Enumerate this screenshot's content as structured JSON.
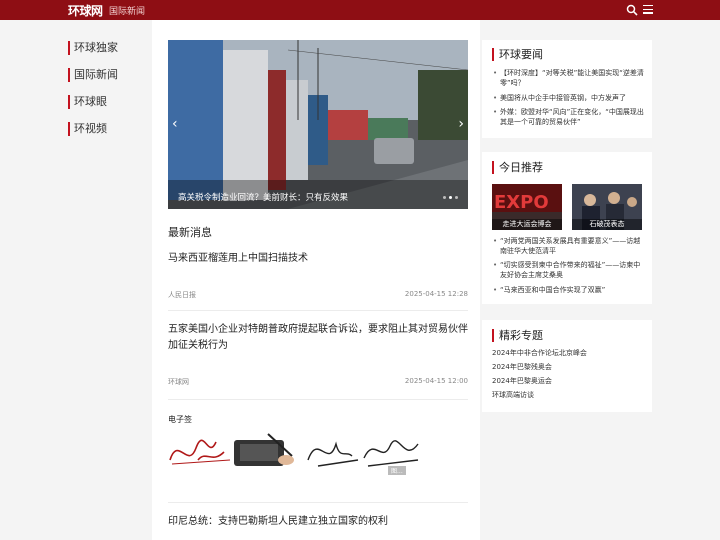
{
  "header": {
    "logo": "环球网",
    "section": "国际新闻"
  },
  "leftnav": {
    "items": [
      {
        "label": "环球独家"
      },
      {
        "label": "国际新闻"
      },
      {
        "label": "环球眼"
      },
      {
        "label": "环视频"
      }
    ]
  },
  "slider": {
    "caption": "高关税令制造业回流？美前财长：只有反效果",
    "total_slides": 3,
    "active_slide": 2
  },
  "latest": {
    "title": "最新消息",
    "items": [
      {
        "title": "马来西亚榴莲用上中国扫描技术",
        "source": "人民日报",
        "date": "2025-04-15 12:28"
      },
      {
        "title": "五家美国小企业对特朗普政府提起联合诉讼，要求阻止其对贸易伙伴加征关税行为",
        "source": "环球网",
        "date": "2025-04-15 12:00"
      }
    ],
    "esig_label": "电子签",
    "esig_watermark": "图...",
    "last_title": "印尼总统：支持巴勒斯坦人民建立独立国家的权利"
  },
  "hot": {
    "title": "环球要闻",
    "items": [
      "【环时深度】“对等关税”能让美国实现“逆差清零”吗？",
      "美国将从中企手中接管英钢，中方发声了",
      "外媒：欧盟对华“风向”正在变化，“中国展现出其是一个可靠的贸易伙伴”"
    ]
  },
  "today": {
    "title": "今日推荐",
    "thumbs": [
      {
        "caption": "走进大运会博会"
      },
      {
        "caption": "石破茂表态"
      }
    ],
    "items": [
      "“对两党两国关系发展具有重要意义”——访越南驻华大使范清平",
      "“切实感受到柬中合作带来的福祉”——访柬中友好协会主席艾桑奥",
      "“马来西亚和中国合作实现了双赢”"
    ]
  },
  "special": {
    "title": "精彩专题",
    "items": [
      "2024年中非合作论坛北京峰会",
      "2024年巴黎残奥会",
      "2024年巴黎奥运会",
      "环球高端访谈"
    ]
  },
  "colors": {
    "brand": "#8e0e14",
    "accent": "#c3121f"
  }
}
